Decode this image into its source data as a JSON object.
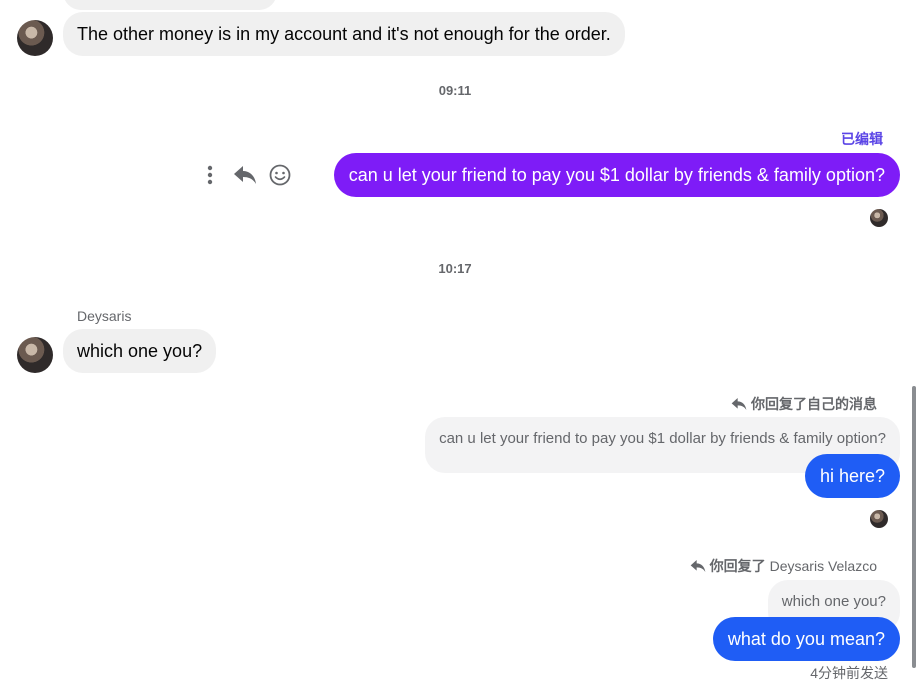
{
  "colors": {
    "purple_bubble": "#7e1cf7",
    "blue_bubble": "#1f5df5",
    "edited_label": "#5b45e6"
  },
  "messages": {
    "m1_text": "The other money is in my account and it's not enough for the order.",
    "time1": "09:11",
    "edited_label": "已编辑",
    "m2_text": "can u let your friend to pay you $1 dollar by friends & family option?",
    "time2": "10:17",
    "sender_name": "Deysaris",
    "m3_text": "which one you?",
    "reply1_prefix": "你回复了自己的消息",
    "reply1_quote": "can u let your friend to pay you $1 dollar by friends & family option?",
    "m4_text": "hi here?",
    "reply2_prefix": "你回复了",
    "reply2_target": "Deysaris Velazco",
    "reply2_quote": "which one you?",
    "m5_text": "what do you mean?",
    "sent_status": "4分钟前发送"
  },
  "icons": {
    "more": "vertical-ellipsis-icon",
    "reply": "reply-arrow-icon",
    "react": "smiley-face-icon"
  }
}
